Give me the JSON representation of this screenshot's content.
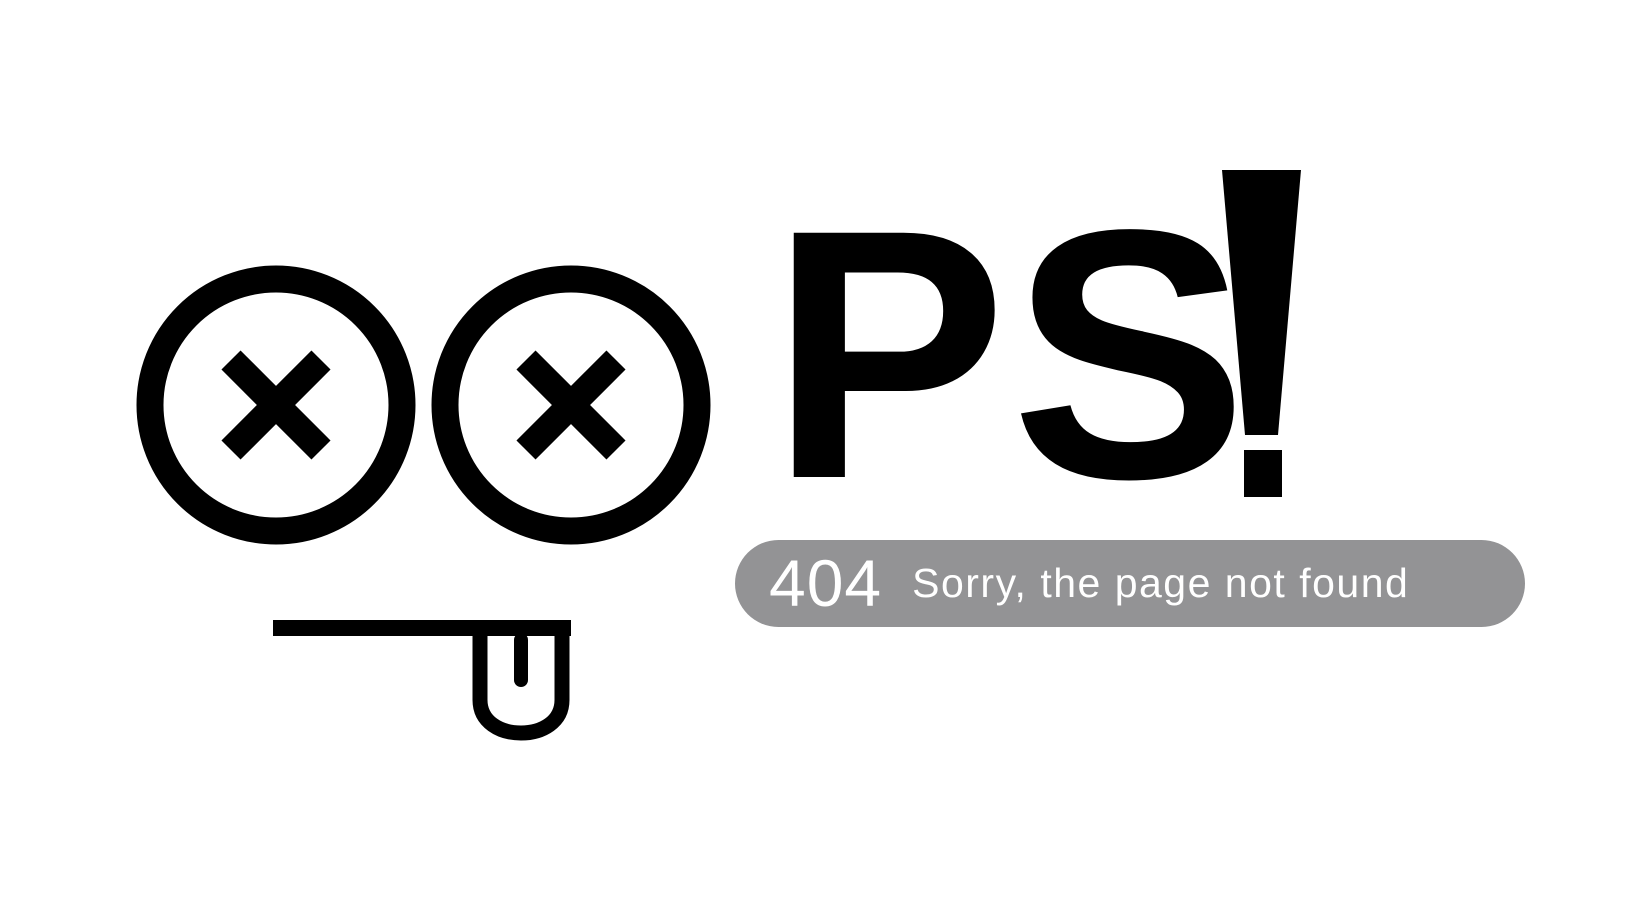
{
  "logo": {
    "word": "PS",
    "exclamation": "!"
  },
  "error": {
    "code": "404",
    "message": "Sorry, the page not found"
  },
  "icons": {
    "left_eye": "x-circle-icon",
    "right_eye": "x-circle-icon",
    "mouth": "tongue-out-mouth-icon",
    "exclamation": "exclamation-mark-icon"
  },
  "colors": {
    "foreground": "#000000",
    "background": "#ffffff",
    "pill": "#939395",
    "pill_text": "#ffffff"
  }
}
